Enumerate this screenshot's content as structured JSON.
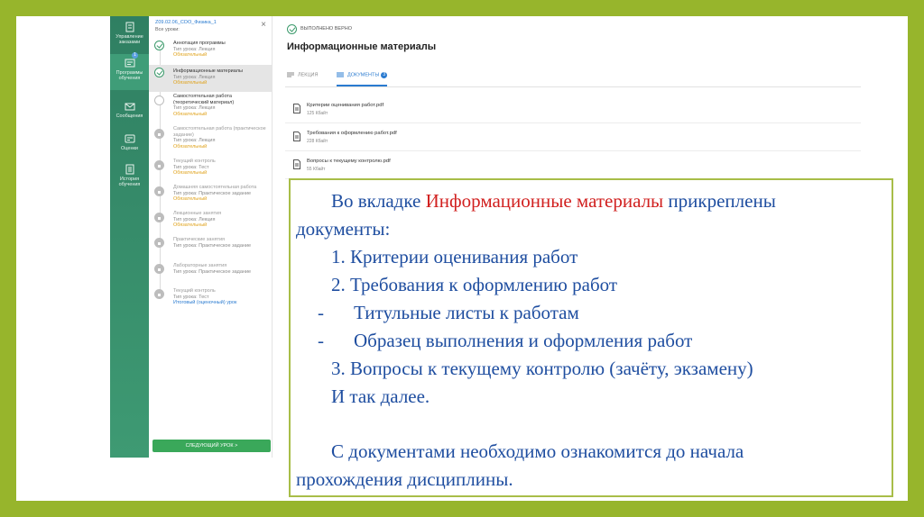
{
  "sidebar": {
    "items": [
      {
        "label": "Управление заказами",
        "icon": "orders-icon"
      },
      {
        "label": "Программы обучения",
        "icon": "programs-icon",
        "badge": "1"
      },
      {
        "label": "Сообщения",
        "icon": "mail-icon"
      },
      {
        "label": "Оценки",
        "icon": "grades-icon"
      },
      {
        "label": "История обучения",
        "icon": "history-icon"
      }
    ]
  },
  "lessons_panel": {
    "course": "Z09.02.06_СОО_Физика_1",
    "all_lessons": "Все уроки:",
    "close": "×",
    "items": [
      {
        "title": "Аннотация программы",
        "type": "Тип урока: Лекция",
        "tag": "Обязательный"
      },
      {
        "title": "Информационные материалы",
        "type": "Тип урока: Лекция",
        "tag": "Обязательный"
      },
      {
        "title": "Самостоятельная работа (теоретический материал)",
        "type": "Тип урока: Лекция",
        "tag": "Обязательный"
      },
      {
        "title": "Самостоятельная работа (практическое задание)",
        "type": "Тип урока: Лекция",
        "tag": "Обязательный"
      },
      {
        "title": "Текущий контроль",
        "type": "Тип урока: Тест",
        "tag": "Обязательный"
      },
      {
        "title": "Домашняя самостоятельная работа",
        "type": "Тип урока: Практическое задание",
        "tag": "Обязательный"
      },
      {
        "title": "Лекционные занятия",
        "type": "Тип урока: Лекция",
        "tag": "Обязательный"
      },
      {
        "title": "Практические занятия",
        "type": "Тип урока: Практическое задание",
        "tag": ""
      },
      {
        "title": "Лабораторные занятия",
        "type": "Тип урока: Практическое задание",
        "tag": ""
      },
      {
        "title": "Текущий контроль",
        "type": "Тип урока: Тест",
        "tag": "Итоговый (оценочный) урок"
      }
    ],
    "next_button": "СЛЕДУЮЩИЙ УРОК  >"
  },
  "content": {
    "status": "ВЫПОЛНЕНО ВЕРНО",
    "title": "Информационные материалы",
    "tabs": [
      {
        "label": "ЛЕКЦИЯ"
      },
      {
        "label": "ДОКУМЕНТЫ",
        "badge": "3"
      }
    ],
    "documents": [
      {
        "name": "Критерии оценивания работ.pdf",
        "size": "125 Кбайт"
      },
      {
        "name": "Требования к оформлению работ.pdf",
        "size": "228 Кбайт"
      },
      {
        "name": "Вопросы к текущему контролю.pdf",
        "size": "55 Кбайт"
      }
    ]
  },
  "note": {
    "intro_pre": "Во вкладке ",
    "intro_highlight": "Информационные материалы",
    "intro_post": " прикреплены",
    "line2": "документы:",
    "item1": "1. Критерии оценивания работ",
    "item2": "2. Требования к оформлению работ",
    "sub1_dash": "-",
    "sub1": "Титульные листы к работам",
    "sub2_dash": "-",
    "sub2": "Образец выполнения и оформления работ",
    "item3": "3. Вопросы к текущему контролю (зачёту, экзамену)",
    "etc": "И так далее.",
    "closing1": "С документами необходимо ознакомится до начала",
    "closing2": "прохождения дисциплины."
  },
  "colors": {
    "frame": "#97b52c",
    "sidebar": "#2f7f62",
    "accent": "#2a7bd0",
    "required": "#e0a21a",
    "highlight": "#d1201f",
    "note_text": "#1f4ea0"
  }
}
